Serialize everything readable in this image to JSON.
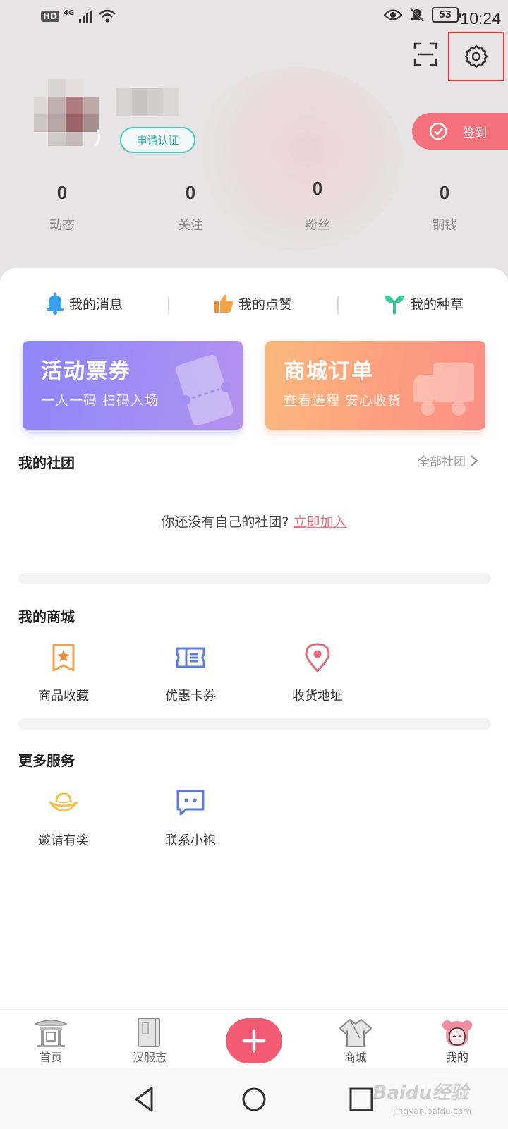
{
  "status_bar": {
    "hd": "HD",
    "network": "4G",
    "battery": "53",
    "time": "10:24"
  },
  "profile": {
    "apply_cert_label": "申请认证",
    "checkin_label": "签到",
    "stats": [
      {
        "value": "0",
        "label": "动态"
      },
      {
        "value": "0",
        "label": "关注"
      },
      {
        "value": "0",
        "label": "粉丝"
      },
      {
        "value": "0",
        "label": "铜钱"
      }
    ]
  },
  "quick_links": [
    {
      "label": "我的消息",
      "icon": "bell-icon"
    },
    {
      "label": "我的点赞",
      "icon": "thumbs-up-icon"
    },
    {
      "label": "我的种草",
      "icon": "sprout-icon"
    }
  ],
  "promo_cards": {
    "tickets": {
      "title": "活动票券",
      "subtitle": "一人一码 扫码入场"
    },
    "orders": {
      "title": "商城订单",
      "subtitle": "查看进程 安心收货"
    }
  },
  "clubs": {
    "title": "我的社团",
    "all_label": "全部社团",
    "empty_text": "你还没有自己的社团?",
    "join_label": "立即加入"
  },
  "shop": {
    "title": "我的商城",
    "items": [
      {
        "label": "商品收藏",
        "icon": "favorite-star-icon"
      },
      {
        "label": "优惠卡券",
        "icon": "coupon-icon"
      },
      {
        "label": "收货地址",
        "icon": "location-pin-icon"
      }
    ]
  },
  "services": {
    "title": "更多服务",
    "items": [
      {
        "label": "邀请有奖",
        "icon": "gold-ingot-icon"
      },
      {
        "label": "联系小袍",
        "icon": "chat-icon"
      }
    ]
  },
  "bottom_nav": {
    "items": [
      {
        "label": "首页"
      },
      {
        "label": "汉服志"
      },
      {
        "label": "商城"
      },
      {
        "label": "我的"
      }
    ]
  },
  "watermark": {
    "text": "Baidu经验",
    "sub": "jingyan.baidu.com"
  },
  "colors": {
    "accent_pink": "#f25a74",
    "checkin_pink": "#f4707b",
    "teal": "#36b3ab",
    "ticket_purple": "#8e86f8",
    "order_orange": "#fbb97c"
  }
}
